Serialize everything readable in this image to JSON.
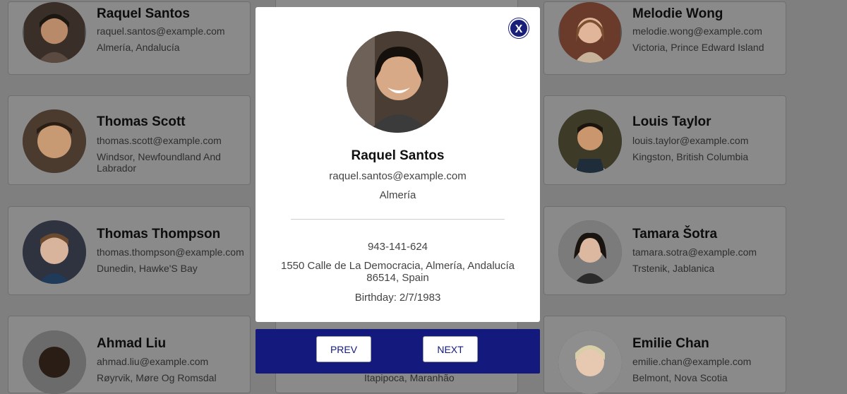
{
  "cards": [
    {
      "name": "Raquel Santos",
      "email": "raquel.santos@example.com",
      "location": "Almería, Andalucía"
    },
    {
      "name": "Melodie Wong",
      "email": "melodie.wong@example.com",
      "location": "Victoria, Prince Edward Island"
    },
    {
      "name": "Thomas Scott",
      "email": "thomas.scott@example.com",
      "location": "Windsor, Newfoundland And Labrador"
    },
    {
      "name": "Louis Taylor",
      "email": "louis.taylor@example.com",
      "location": "Kingston, British Columbia"
    },
    {
      "name": "Thomas Thompson",
      "email": "thomas.thompson@example.com",
      "location": "Dunedin, Hawke'S Bay"
    },
    {
      "name": "Tamara Šotra",
      "email": "tamara.sotra@example.com",
      "location": "Trstenik, Jablanica"
    },
    {
      "name": "Ahmad Liu",
      "email": "ahmad.liu@example.com",
      "location": "Røyrvik, Møre Og Romsdal"
    },
    {
      "name": "Emilie Chan",
      "email": "emilie.chan@example.com",
      "location": "Belmont, Nova Scotia"
    },
    {
      "name": "",
      "email": "",
      "location": "Itapipoca, Maranhão"
    }
  ],
  "modal": {
    "close_label": "X",
    "name": "Raquel Santos",
    "email": "raquel.santos@example.com",
    "city": "Almería",
    "phone": "943-141-624",
    "address": "1550 Calle de La Democracia, Almería, Andalucía 86514, Spain",
    "birthday_label": "Birthday:",
    "birthday": "2/7/1983"
  },
  "nav": {
    "prev_label": "PREV",
    "next_label": "NEXT"
  },
  "colors": {
    "overlay": "#7f7f7f",
    "nav_bar": "#13197d",
    "close_button": "#1a1f7a"
  }
}
